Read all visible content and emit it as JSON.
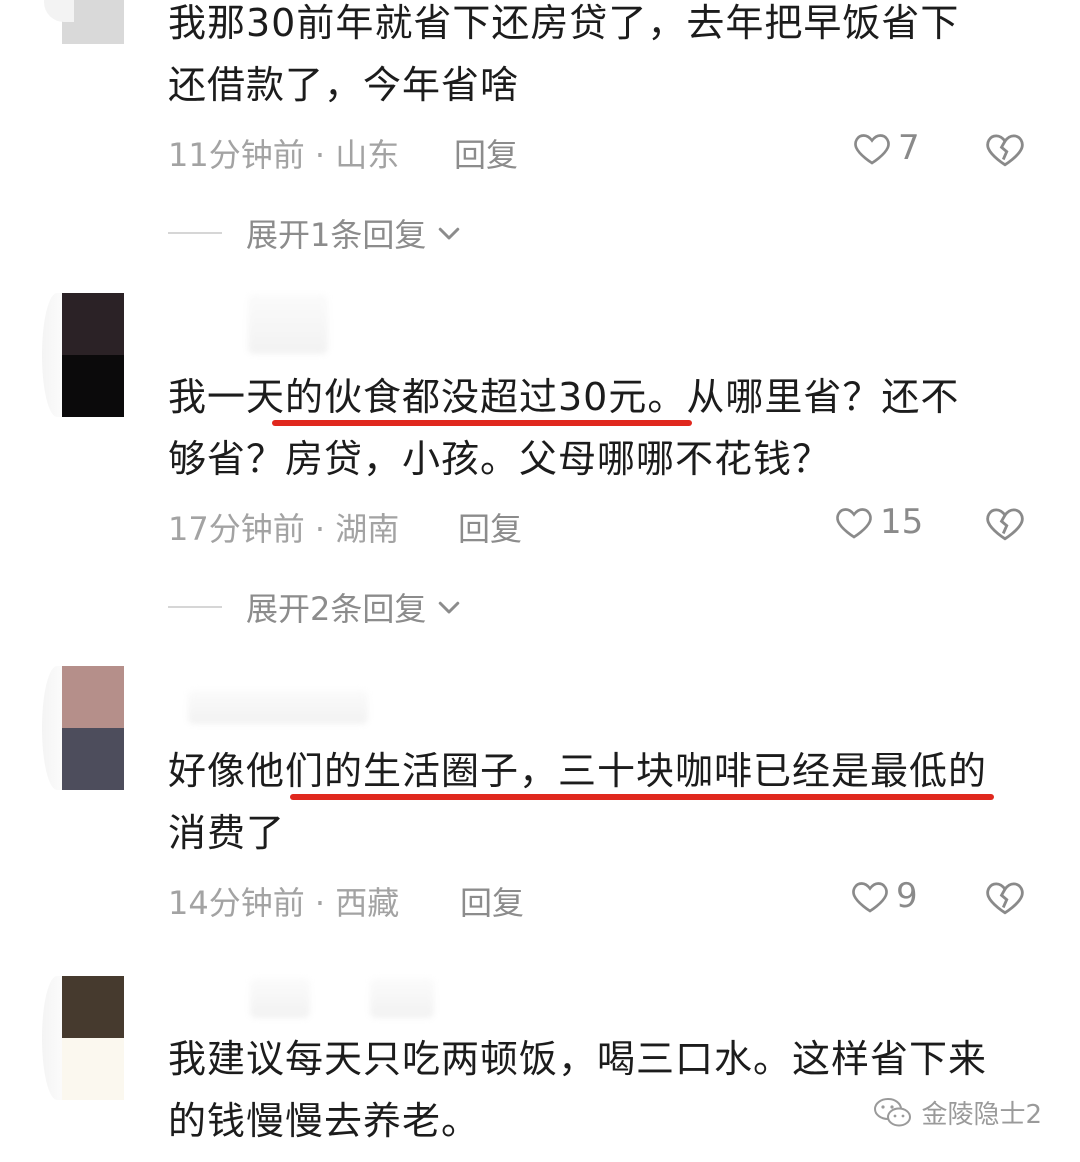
{
  "comments": [
    {
      "text_lines": [
        "我那30前年就省下还房贷了，去年把早饭省下",
        "还借款了，今年省啥"
      ],
      "meta": "11分钟前 · 山东",
      "reply_label": "回复",
      "likes": "7",
      "expand_label": "展开1条回复"
    },
    {
      "text_lines": [
        "我一天的伙食都没超过30元。从哪里省？还不",
        "够省？房贷，小孩。父母哪哪不花钱？"
      ],
      "meta": "17分钟前 · 湖南",
      "reply_label": "回复",
      "likes": "15",
      "expand_label": "展开2条回复"
    },
    {
      "text_lines": [
        "好像他们的生活圈子，三十块咖啡已经是最低的",
        "消费了"
      ],
      "meta": "14分钟前 · 西藏",
      "reply_label": "回复",
      "likes": "9"
    },
    {
      "text_lines": [
        "我建议每天只吃两顿饭，喝三口水。这样省下来",
        "的钱慢慢去养老。"
      ]
    }
  ],
  "watermark": "金陵隐士2",
  "colors": {
    "highlight_underline": "#e0281e",
    "meta_gray": "#a3a3a3",
    "text": "#1c1c1c"
  },
  "icons": {
    "like": "heart-outline-icon",
    "dislike": "broken-heart-icon",
    "expand": "chevron-down-icon",
    "watermark": "wechat-icon"
  }
}
